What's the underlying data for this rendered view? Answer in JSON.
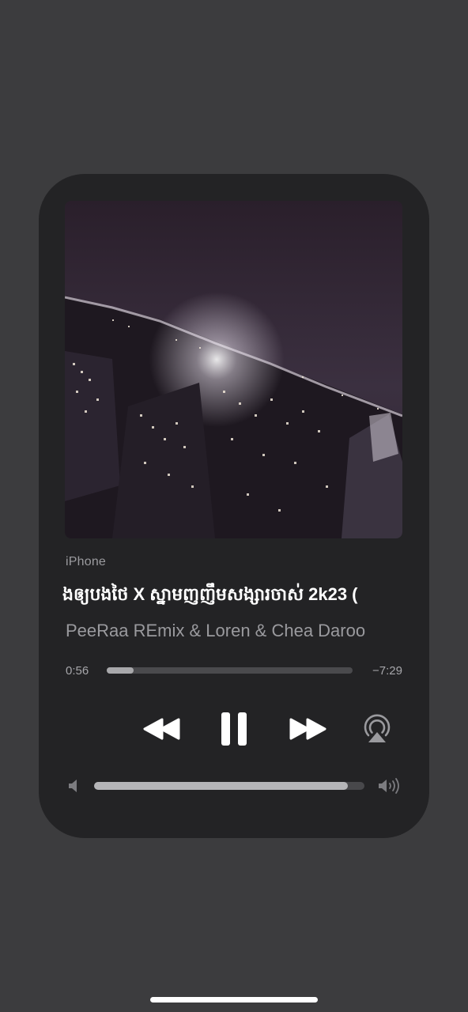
{
  "player": {
    "source": "iPhone",
    "title": "ងឲ្យបងថៃ X ស្នាមញញឹមសង្សារចាស់ 2k23 (",
    "artist": "PeeRaa REmix & Loren & Chea Daroo",
    "elapsed": "0:56",
    "remaining": "−7:29",
    "progress_fraction": 0.11,
    "volume_fraction": 0.94,
    "state": "playing"
  },
  "icons": {
    "rewind": "rewind-icon",
    "pause": "pause-icon",
    "forward": "fast-forward-icon",
    "airplay": "airplay-icon",
    "volume_low": "speaker-low-icon",
    "volume_high": "speaker-high-icon"
  },
  "colors": {
    "background": "#3c3c3e",
    "card": "#232325",
    "text_primary": "#ffffff",
    "text_secondary": "#9a9a9e"
  }
}
